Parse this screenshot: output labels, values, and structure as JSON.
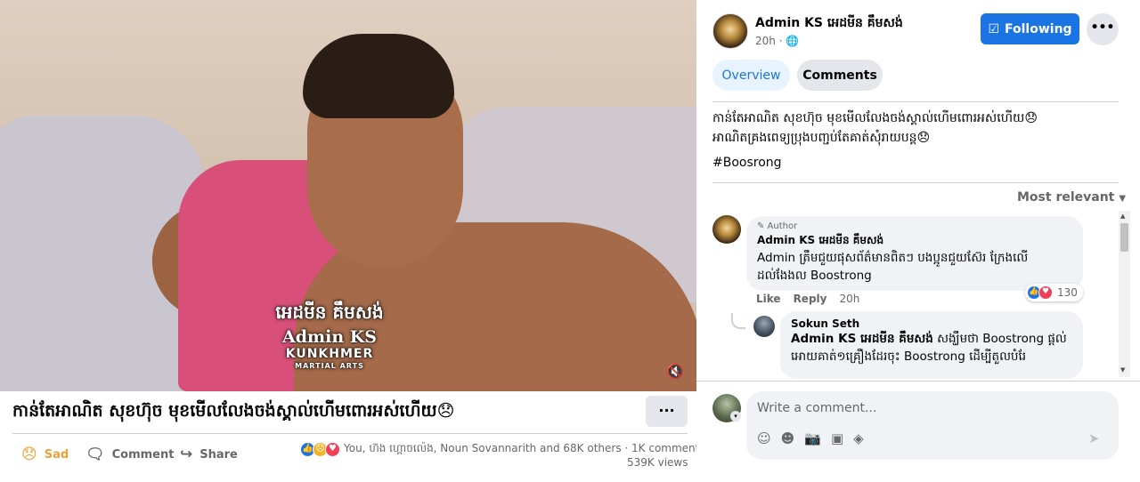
{
  "video": {
    "watermark_khmer": "អេដមីន គឹមសង់",
    "watermark_admin": "Admin KS",
    "watermark_brand": "KUNKHMER",
    "watermark_sub": "MARTIAL ARTS",
    "mute_icon": "speaker-muted-icon"
  },
  "post": {
    "title": "កាន់តែអាណិត សុខហ៊ុច មុខមើលលែងចង់ស្គាល់ហើមពោរអស់ហើយ😞",
    "more_label": "···",
    "actions": {
      "sad_label": "Sad",
      "comment_label": "Comment",
      "share_label": "Share"
    },
    "reactions_text": "You, ហ៊ង ហ្គោចល៉េង, Noun Sovannarith and 68K others · 1K comments ·",
    "views": "539K views"
  },
  "panel": {
    "page_name": "Admin KS អេដមីន គឹមសង់",
    "time": "20h · 🌐",
    "follow_label": "Following",
    "more_label": "•••",
    "tabs": {
      "overview": "Overview",
      "comments": "Comments"
    },
    "post_text_line1": "កាន់តែអាណិត សុខហ៊ុច មុខមើលលែងចង់ស្គាល់ហើមពោរអស់ហើយ😞",
    "post_text_line2": "អាណិតគ្រងពេទ្យប្រុងបញ្ជប់តែគាត់សុំរាយបន្ត😞",
    "hashtag": "#Boosrong",
    "sort_label": "Most relevant",
    "comment1": {
      "badge": "✎ Author",
      "name": "Admin KS អេដមីន គឹមសង់",
      "text": "Admin ត្រឹមជួយផុសព័ត៌មានពិតៗ បងប្អូនជួយស៊ែរ ក្រែងលើដល់ងែងល Boostrong",
      "like": "Like",
      "reply": "Reply",
      "time": "20h",
      "react_count": "130"
    },
    "comment2": {
      "name": "Sokun Seth",
      "mention": "Admin KS អេដមីន គឹមសង់",
      "text": " សង្ឃឹមថា Boostrong ផ្តល់អោយគាត់១គ្រឿងដែរចុះ Boostrong ដើម្បីតួលបំរែ"
    },
    "compose_placeholder": "Write a comment..."
  }
}
